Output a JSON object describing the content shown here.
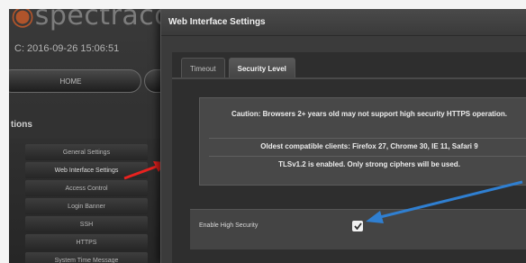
{
  "brand": {
    "logo_text": "spectracom"
  },
  "header": {
    "datetime": "C: 2016-09-26 15:06:51"
  },
  "nav": {
    "home_label": "HOME",
    "second_pill_label": ""
  },
  "sidebar": {
    "title": "tions",
    "items": [
      {
        "label": "General Settings"
      },
      {
        "label": "Web Interface Settings"
      },
      {
        "label": "Access Control"
      },
      {
        "label": "Login Banner"
      },
      {
        "label": "SSH"
      },
      {
        "label": "HTTPS"
      },
      {
        "label": "System Time Message"
      }
    ]
  },
  "dialog": {
    "title": "Web Interface Settings",
    "tabs": [
      {
        "label": "Timeout"
      },
      {
        "label": "Security Level"
      }
    ],
    "active_tab": "Security Level",
    "caution": "Caution: Browsers 2+ years old may not support high security HTTPS operation.",
    "compat": "Oldest compatible clients: Firefox 27, Chrome 30, IE 11, Safari 9",
    "tls": "TLSv1.2 is enabled. Only strong ciphers will be used.",
    "enable_high_security": {
      "label": "Enable High Security",
      "checked": true
    }
  },
  "annotations": {
    "red_arrow_color": "#e8221f",
    "blue_arrow_color": "#2f7fd1"
  },
  "colors": {
    "logo_accent": "#b0542b"
  }
}
